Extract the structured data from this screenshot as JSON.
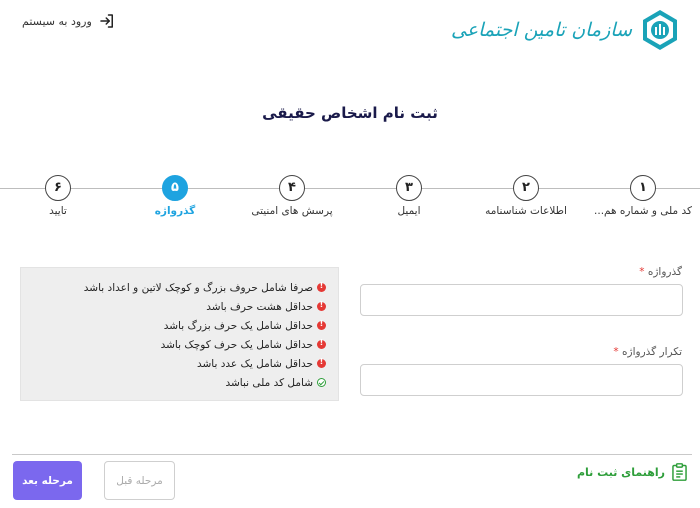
{
  "header": {
    "login_label": "ورود به سیستم",
    "login_icon": "login-icon",
    "logo_text": "سازمان تامین اجتماعی",
    "logo_icon": "social-security-emblem"
  },
  "page_title": "ثبت نام اشخاص حقیقی",
  "stepper": {
    "steps": [
      {
        "number": "۱",
        "label": "کد ملی و شماره هم...",
        "active": false
      },
      {
        "number": "۲",
        "label": "اطلاعات شناسنامه",
        "active": false
      },
      {
        "number": "۳",
        "label": "ایمیل",
        "active": false
      },
      {
        "number": "۴",
        "label": "پرسش های امنیتی",
        "active": false
      },
      {
        "number": "۵",
        "label": "گذرواژه",
        "active": true
      },
      {
        "number": "۶",
        "label": "تایید",
        "active": false
      }
    ]
  },
  "rules": [
    {
      "text": "صرفا شامل حروف بزرگ و کوچک لاتین و اعداد باشد",
      "status": "error"
    },
    {
      "text": "حداقل هشت حرف باشد",
      "status": "error"
    },
    {
      "text": "حداقل شامل یک حرف بزرگ باشد",
      "status": "error"
    },
    {
      "text": "حداقل شامل یک حرف کوچک باشد",
      "status": "error"
    },
    {
      "text": "حداقل شامل یک عدد باشد",
      "status": "error"
    },
    {
      "text": "شامل کد ملی نباشد",
      "status": "ok"
    }
  ],
  "form": {
    "password_label": "گذرواژه",
    "password_value": "",
    "confirm_label": "تکرار گذرواژه",
    "confirm_value": "",
    "required_mark": "*"
  },
  "footer": {
    "next_label": "مرحله بعد",
    "prev_label": "مرحله قبل",
    "guide_label": "راهنمای ثبت نام",
    "guide_icon": "clipboard-list-icon"
  },
  "colors": {
    "accent": "#1ea3e0",
    "primary_button": "#7b68ee",
    "error": "#e53935",
    "success": "#2e9e3a",
    "logo": "#1aa3b8"
  }
}
